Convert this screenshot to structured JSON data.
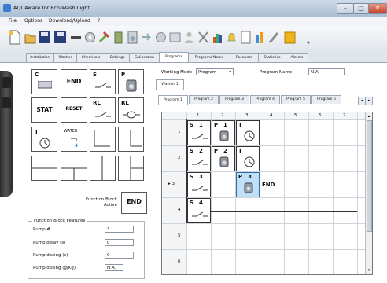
{
  "window": {
    "title": "AQUAware for Eco-Wash Light"
  },
  "menu": [
    "File",
    "Options",
    "Download/Upload",
    "?"
  ],
  "tabs": [
    "Installation",
    "Washer",
    "Chemicals",
    "Settings",
    "Calibration",
    "Programs",
    "Programs Name",
    "Password",
    "Statistics",
    "Alarms"
  ],
  "active_tab": "Programs",
  "palette": {
    "items": [
      {
        "top": "C",
        "center": "",
        "icon": "counter"
      },
      {
        "top": "",
        "center": "END",
        "icon": ""
      },
      {
        "top": "S",
        "center": "",
        "icon": "switch"
      },
      {
        "top": "P",
        "center": "",
        "icon": "pump"
      },
      {
        "top": "",
        "center": "STAT",
        "icon": ""
      },
      {
        "top": "",
        "center": "RESET",
        "icon": ""
      },
      {
        "top": "RL",
        "center": "",
        "icon": "switch"
      },
      {
        "top": "RL",
        "center": "",
        "icon": "coil"
      },
      {
        "top": "T",
        "center": "",
        "icon": "timer"
      },
      {
        "top": "WATER",
        "center": "",
        "icon": "water"
      },
      {
        "top": "",
        "center": "",
        "icon": "wire"
      },
      {
        "top": "",
        "center": "",
        "icon": "wire"
      },
      {
        "top": "",
        "center": "",
        "icon": "wire"
      },
      {
        "top": "",
        "center": "",
        "icon": "wire"
      },
      {
        "top": "",
        "center": "",
        "icon": "wire"
      },
      {
        "top": "",
        "center": "",
        "icon": "wire"
      }
    ],
    "function_block_label": "Function Block Active",
    "function_block_value": "END"
  },
  "features": {
    "title": "Function Block Features",
    "fields": [
      {
        "label": "Pump #",
        "value": "3"
      },
      {
        "label": "Pump delay (s)",
        "value": "0"
      },
      {
        "label": "Pump dosing (s)",
        "value": "0"
      },
      {
        "label": "Pump dosing (g/Kg)",
        "value": "N.A."
      }
    ]
  },
  "working_mode": {
    "label": "Working Mode",
    "value": "Program"
  },
  "program_name": {
    "label": "Program Name",
    "value": "N.A."
  },
  "washer_tab": "Washer 1",
  "program_tabs": [
    "Program 1",
    "Program 2",
    "Program 3",
    "Program 4",
    "Program 5",
    "Program 6"
  ],
  "grid": {
    "columns": [
      "1",
      "2",
      "3",
      "4",
      "5",
      "6",
      "7"
    ],
    "rows": [
      "1",
      "2",
      "3",
      "4",
      "5",
      "6"
    ],
    "current_row": "3",
    "blocks": [
      {
        "row": 1,
        "col": 1,
        "type": "S",
        "num": "1",
        "icon": "switch"
      },
      {
        "row": 1,
        "col": 2,
        "type": "P",
        "num": "1",
        "icon": "pump"
      },
      {
        "row": 1,
        "col": 3,
        "type": "T",
        "num": "",
        "icon": "timer"
      },
      {
        "row": 2,
        "col": 1,
        "type": "S",
        "num": "2",
        "icon": "switch"
      },
      {
        "row": 2,
        "col": 2,
        "type": "P",
        "num": "2",
        "icon": "pump"
      },
      {
        "row": 2,
        "col": 3,
        "type": "T",
        "num": "",
        "icon": "timer"
      },
      {
        "row": 3,
        "col": 1,
        "type": "S",
        "num": "3",
        "icon": "switch"
      },
      {
        "row": 3,
        "col": 3,
        "type": "P",
        "num": "3",
        "icon": "pump",
        "selected": true
      },
      {
        "row": 3,
        "col": 4,
        "type": "END",
        "num": "",
        "icon": ""
      },
      {
        "row": 4,
        "col": 1,
        "type": "S",
        "num": "4",
        "icon": "switch"
      }
    ]
  }
}
